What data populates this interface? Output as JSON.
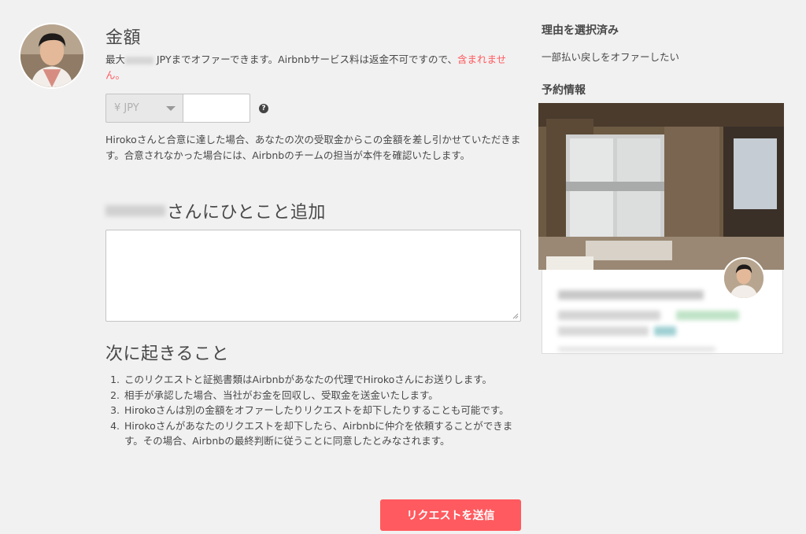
{
  "amount": {
    "title": "金額",
    "max_prefix": "最大",
    "max_suffix": " JPYまでオファーできます。Airbnbサービス料は返金不可ですので、",
    "max_red": "含まれません。",
    "currency": "¥ JPY",
    "help_icon_text": "?",
    "agree_text": "Hirokoさんと合意に達した場合、あなたの次の受取金からこの金額を差し引かせていただきます。合意されなかった場合には、Airbnbのチームの担当が本件を確認いたします。"
  },
  "message": {
    "title_suffix": "さんにひとこと追加"
  },
  "next_steps": {
    "title": "次に起きること",
    "items": [
      "このリクエストと証拠書類はAirbnbがあなたの代理でHirokoさんにお送りします。",
      "相手が承認した場合、当社がお金を回収し、受取金を送金いたします。",
      "Hirokoさんは別の金額をオファーしたりリクエストを却下したりすることも可能です。",
      "Hirokoさんがあなたのリクエストを却下したら、Airbnbに仲介を依頼することができます。その場合、Airbnbの最終判断に従うことに同意したとみなされます。"
    ]
  },
  "submit_label": "リクエストを送信",
  "sidebar": {
    "reason_title": "理由を選択済み",
    "reason_value": "一部払い戻しをオファーしたい",
    "booking_title": "予約情報"
  },
  "colors": {
    "accent": "#ff5a5f",
    "background": "#f1f1f1",
    "text": "#484848"
  }
}
